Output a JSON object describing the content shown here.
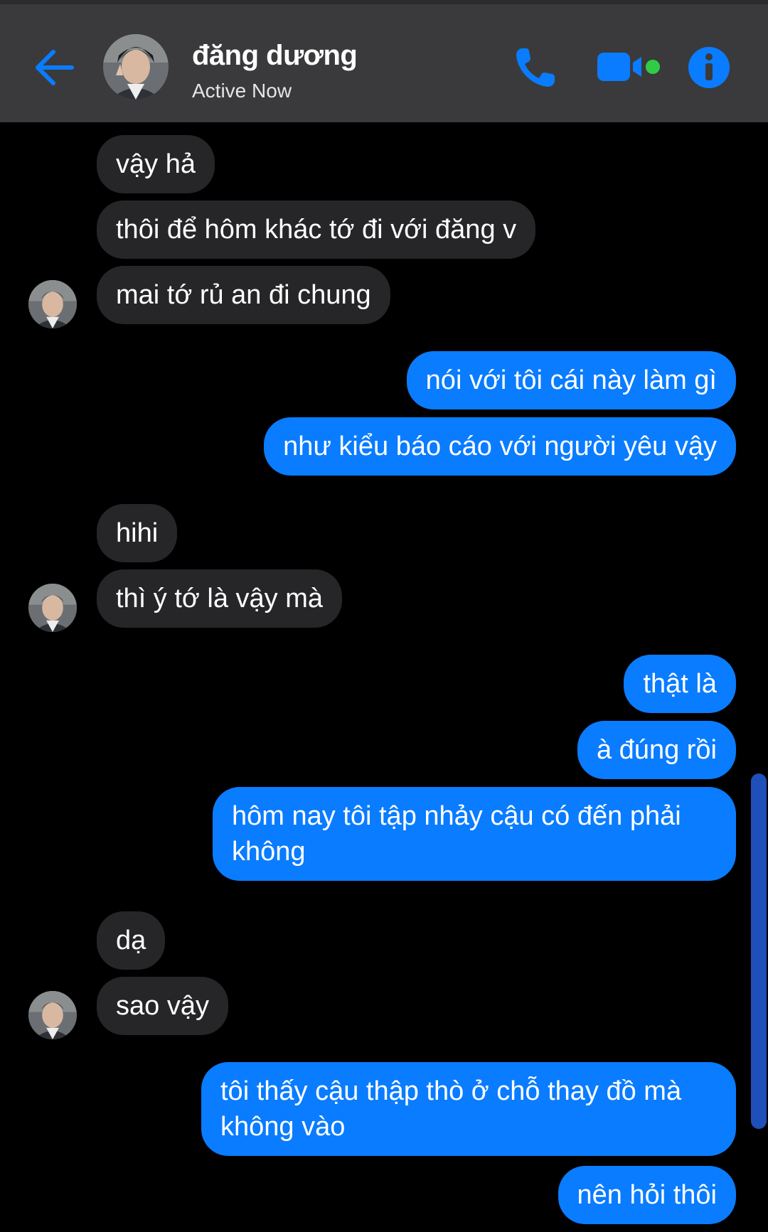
{
  "header": {
    "contact_name": "đăng dương",
    "status": "Active Now",
    "back_icon": "arrow-left-icon",
    "call_icon": "phone-icon",
    "video_icon": "video-camera-icon",
    "info_icon": "info-icon"
  },
  "colors": {
    "accent": "#0a7cff",
    "incoming_bubble": "#262628",
    "header_bg": "#3a3a3c",
    "online_dot": "#31cc46"
  },
  "messages": [
    {
      "direction": "in",
      "text": "vậy hả"
    },
    {
      "direction": "in",
      "text": "thôi để hôm khác tớ đi với đăng v"
    },
    {
      "direction": "in",
      "text": "mai tớ rủ an đi chung"
    },
    {
      "direction": "out",
      "text": "nói với tôi cái này làm gì"
    },
    {
      "direction": "out",
      "text": "như kiểu báo cáo với người yêu vậy"
    },
    {
      "direction": "in",
      "text": "hihi"
    },
    {
      "direction": "in",
      "text": "thì ý tớ là vậy mà"
    },
    {
      "direction": "out",
      "text": "thật là"
    },
    {
      "direction": "out",
      "text": "à đúng rồi"
    },
    {
      "direction": "out",
      "text": "hôm nay tôi tập nhảy cậu có đến phải không"
    },
    {
      "direction": "in",
      "text": "dạ"
    },
    {
      "direction": "in",
      "text": "sao vậy"
    },
    {
      "direction": "out",
      "text": "tôi thấy cậu thập thò ở chỗ thay đồ mà không vào"
    },
    {
      "direction": "out",
      "text": "nên hỏi thôi"
    }
  ]
}
